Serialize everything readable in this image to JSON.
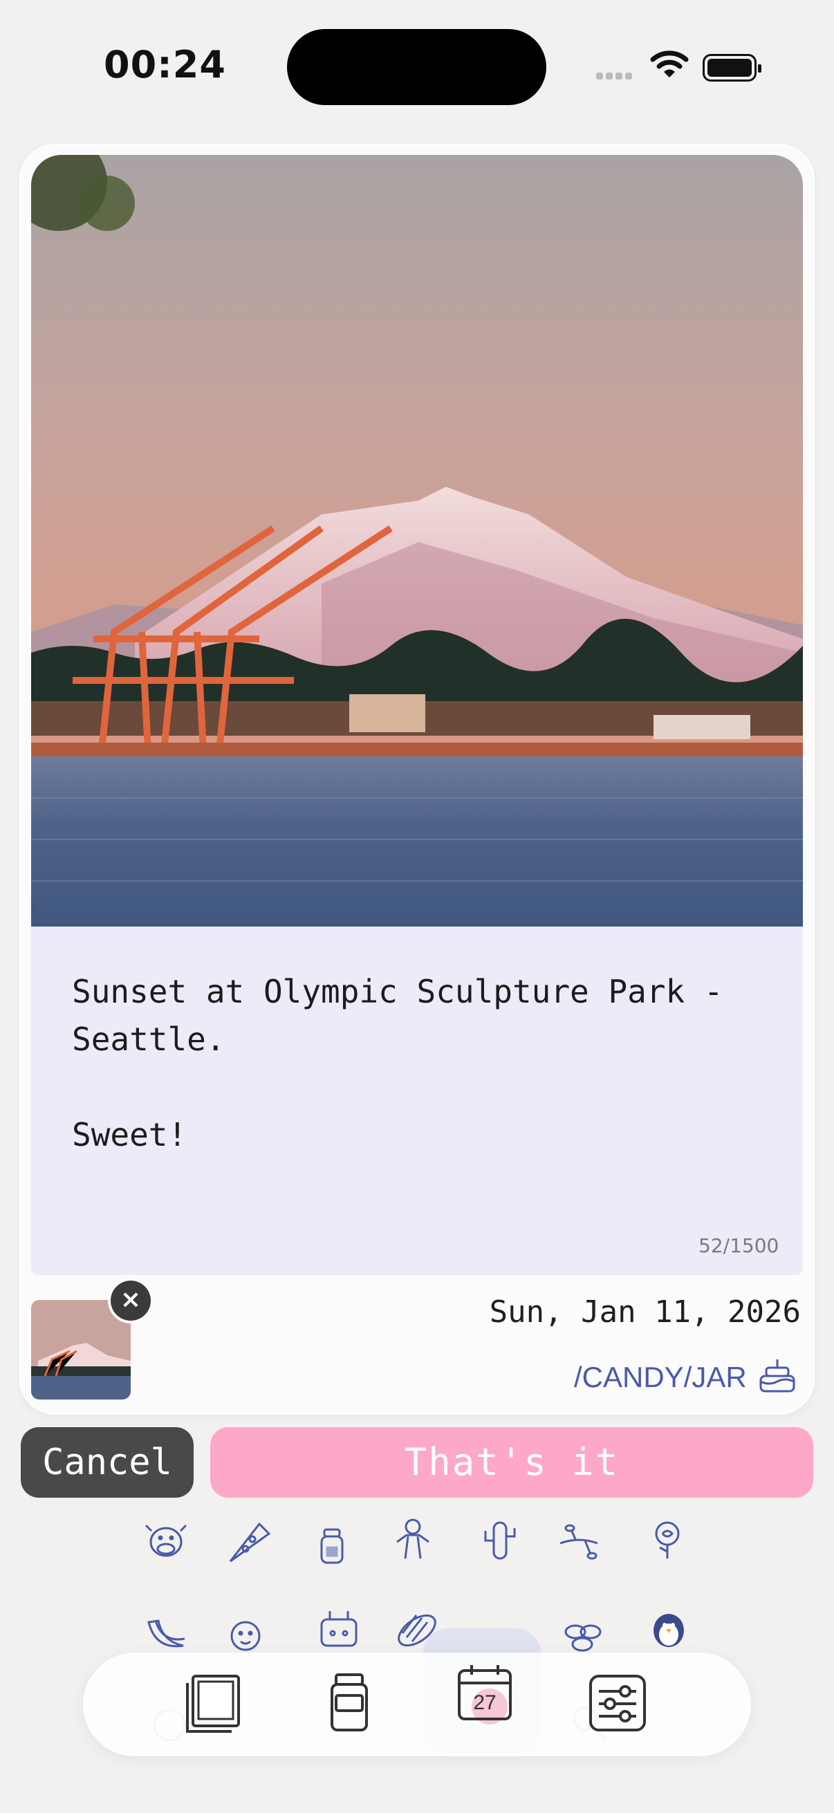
{
  "status_bar": {
    "time": "00:24"
  },
  "entry": {
    "note_text": "Sunset at Olympic Sculpture Park - Seattle.\n\nSweet!",
    "char_counter": "52/1500",
    "date": "Sun, Jan 11, 2026",
    "jar_path": "/CANDY/JAR"
  },
  "photo": {
    "description_icon": "photo-mount-rainier"
  },
  "actions": {
    "cancel_label": "Cancel",
    "confirm_label": "That's it"
  },
  "stickers": {
    "row1": [
      "cow-icon",
      "pizza-icon",
      "jar-icon",
      "gingerbread-icon",
      "cactus-icon",
      "branch-icon",
      "rose-icon"
    ],
    "row2": [
      "banana-icon",
      "face-icon",
      "toaster-icon",
      "candy-icon",
      "plant-icon",
      "beans-icon",
      "penguin-icon"
    ]
  },
  "tabbar": {
    "tabs": [
      "photos-tab",
      "jar-tab",
      "calendar-tab",
      "settings-tab"
    ],
    "active": "calendar-tab",
    "calendar_day": "27"
  },
  "colors": {
    "accent_pink": "#fda8c9",
    "text_blue": "#4a5aa8",
    "note_bg": "#ecebf8"
  }
}
